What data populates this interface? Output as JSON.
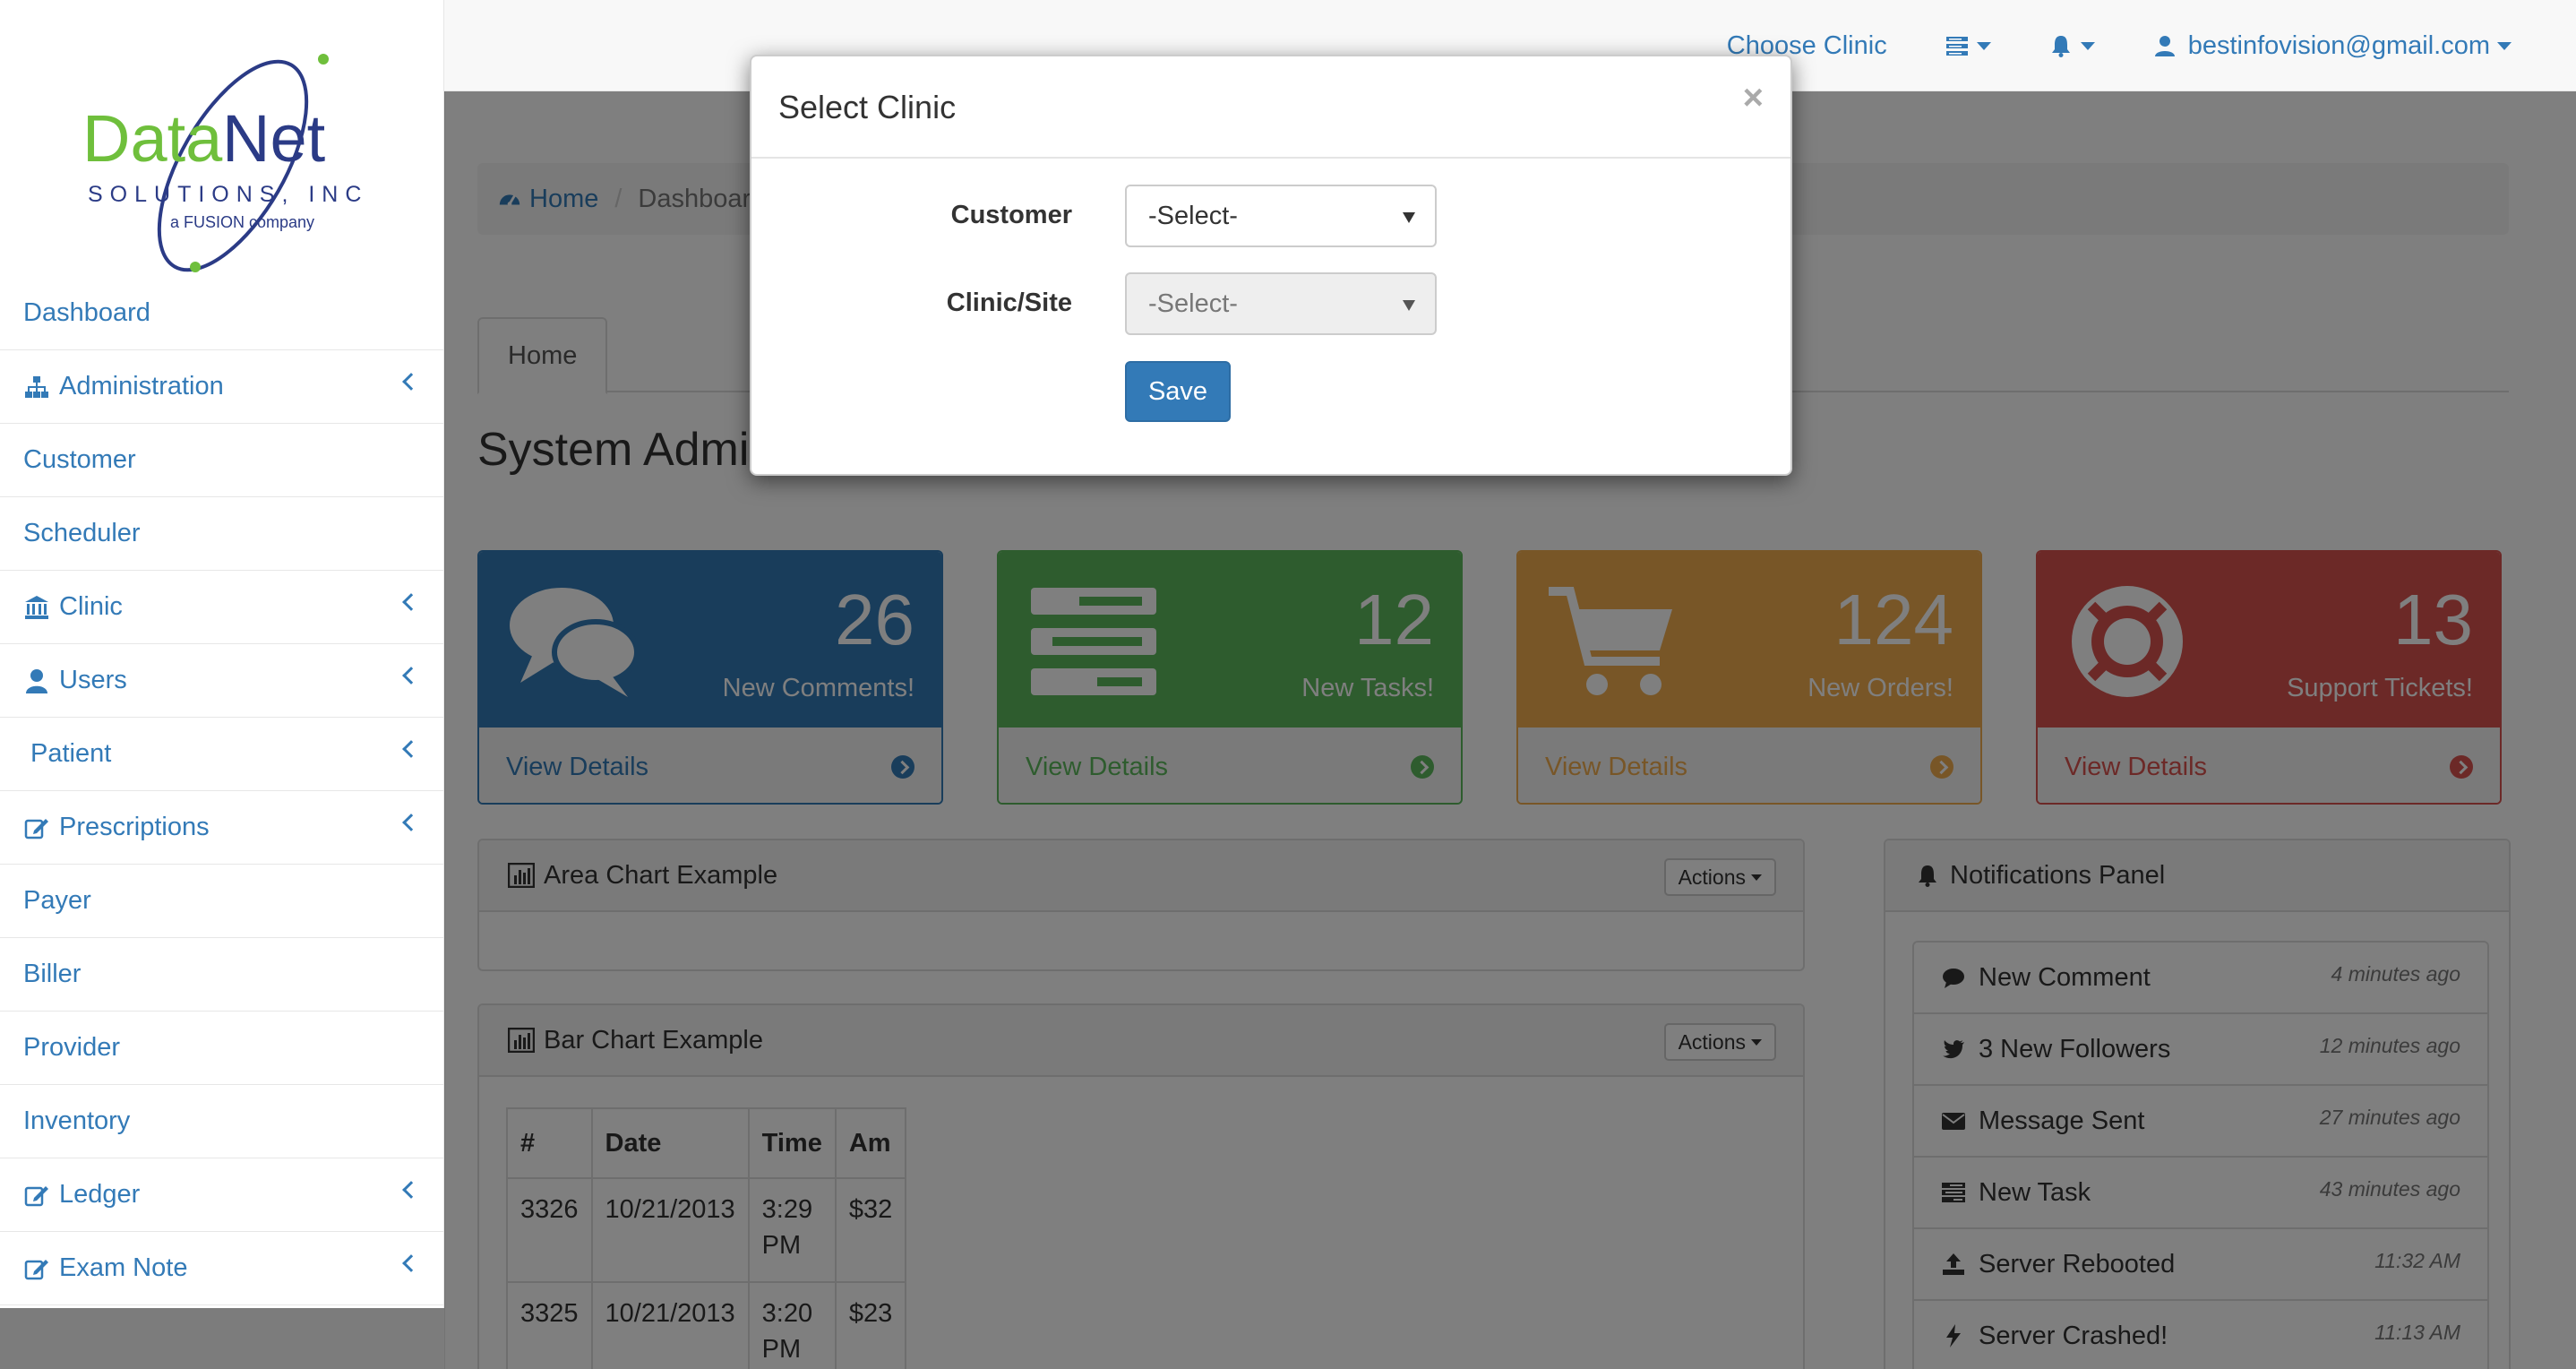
{
  "brand": {
    "name": "DataNet",
    "subtitle": "SOLUTIONS, INC",
    "tagline": "a FUSION company",
    "colors": {
      "data": "#6fbf3c",
      "net": "#2b3b86",
      "orbit": "#2b3b86"
    }
  },
  "navbar": {
    "choose_clinic": "Choose Clinic",
    "user_email": "bestinfovision@gmail.com",
    "icons": [
      "list-icon",
      "bell-icon",
      "user-icon"
    ]
  },
  "sidebar": {
    "items": [
      {
        "label": "Dashboard",
        "icon": "",
        "expandable": false
      },
      {
        "label": "Administration",
        "icon": "sitemap-icon",
        "expandable": true
      },
      {
        "label": "Customer",
        "icon": "",
        "expandable": false
      },
      {
        "label": "Scheduler",
        "icon": "",
        "expandable": false
      },
      {
        "label": "Clinic",
        "icon": "bank-icon",
        "expandable": true
      },
      {
        "label": "Users",
        "icon": "user-icon",
        "expandable": true
      },
      {
        "label": "Patient",
        "icon": "",
        "expandable": true
      },
      {
        "label": "Prescriptions",
        "icon": "edit-icon",
        "expandable": true
      },
      {
        "label": "Payer",
        "icon": "",
        "expandable": false
      },
      {
        "label": "Biller",
        "icon": "",
        "expandable": false
      },
      {
        "label": "Provider",
        "icon": "",
        "expandable": false
      },
      {
        "label": "Inventory",
        "icon": "",
        "expandable": false
      },
      {
        "label": "Ledger",
        "icon": "edit-icon",
        "expandable": true
      },
      {
        "label": "Exam Note",
        "icon": "edit-icon",
        "expandable": true
      }
    ]
  },
  "breadcrumb": {
    "home": "Home",
    "current": "Dashboard"
  },
  "tabs": [
    {
      "label": "Home"
    }
  ],
  "page_title": "System Administrator Dashboard",
  "stat_panels": [
    {
      "count": "26",
      "label": "New Comments!",
      "link": "View Details",
      "color": "#337ab7",
      "icon": "comments-icon"
    },
    {
      "count": "12",
      "label": "New Tasks!",
      "link": "View Details",
      "color": "#5cb85c",
      "icon": "tasks-icon"
    },
    {
      "count": "124",
      "label": "New Orders!",
      "link": "View Details",
      "color": "#f0ad4e",
      "icon": "cart-icon"
    },
    {
      "count": "13",
      "label": "Support Tickets!",
      "link": "View Details",
      "color": "#d9534f",
      "icon": "support-icon"
    }
  ],
  "area_chart": {
    "title": "Area Chart Example",
    "actions": "Actions"
  },
  "bar_chart": {
    "title": "Bar Chart Example",
    "actions": "Actions",
    "table": {
      "headers": [
        "#",
        "Date",
        "Time",
        "Am"
      ],
      "rows": [
        [
          "3326",
          "10/21/2013",
          "3:29 PM",
          "$32"
        ],
        [
          "3325",
          "10/21/2013",
          "3:20 PM",
          "$23"
        ]
      ]
    }
  },
  "notifications": {
    "title": "Notifications Panel",
    "items": [
      {
        "label": "New Comment",
        "time": "4 minutes ago",
        "icon": "comment-icon"
      },
      {
        "label": "3 New Followers",
        "time": "12 minutes ago",
        "icon": "twitter-icon"
      },
      {
        "label": "Message Sent",
        "time": "27 minutes ago",
        "icon": "envelope-icon"
      },
      {
        "label": "New Task",
        "time": "43 minutes ago",
        "icon": "tasks-icon"
      },
      {
        "label": "Server Rebooted",
        "time": "11:32 AM",
        "icon": "upload-icon"
      },
      {
        "label": "Server Crashed!",
        "time": "11:13 AM",
        "icon": "bolt-icon"
      }
    ]
  },
  "modal": {
    "title": "Select Clinic",
    "close": "×",
    "customer_label": "Customer",
    "customer_value": "-Select-",
    "clinic_label": "Clinic/Site",
    "clinic_value": "-Select-",
    "save": "Save"
  }
}
